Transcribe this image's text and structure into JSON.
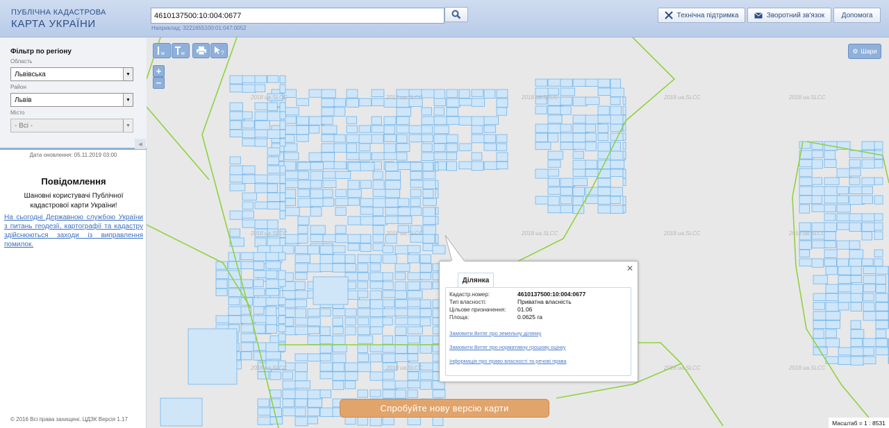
{
  "header": {
    "logo_line1": "ПУБЛІЧНА КАДАСТРОВА",
    "logo_line2": "КАРТА УКРАЇНИ",
    "search_value": "4610137500:10:004:0677",
    "hint": "Наприклад: 3221655100:01:047:0052",
    "buttons": {
      "support": "Технічна підтримка",
      "feedback": "Зворотний зв'язок",
      "help": "Допомога"
    }
  },
  "sidebar": {
    "filter_title": "Фільтр по регіону",
    "oblast_label": "Область",
    "oblast_value": "Львівська",
    "rayon_label": "Район",
    "rayon_value": "Львів",
    "city_label": "Місто",
    "city_value": "- Всі -",
    "update_date": "Дата оновлення: 05.11.2019 03:00",
    "notice_title": "Повідомлення",
    "notice_text": "Шановні користувачі Публічної кадастрової карти України!",
    "notice_link": "На сьогодні Державною службою України з питань геодезії, картографії та кадастру здійснюються заходи із виправлення помилок.",
    "copyright": "© 2016 Всі права захищені. ЦДЗК Версія 1.17"
  },
  "map": {
    "layers_label": "Шари",
    "watermark": "2018 ua.SLCC",
    "new_version": "Спробуйте нову версію карти",
    "scale": "Масштаб = 1 : 8531",
    "zoom_in": "+",
    "zoom_out": "−"
  },
  "popup": {
    "tab": "Ділянка",
    "rows": [
      {
        "k": "Кадастр.номер:",
        "v": "4610137500:10:004:0677"
      },
      {
        "k": "Тип власності:",
        "v": "Приватна власність"
      },
      {
        "k": "Цільове призначення:",
        "v": "01.06"
      },
      {
        "k": "Площа:",
        "v": "0.0625 га"
      }
    ],
    "links": [
      "Замовити Витяг про земельну ділянку",
      "Замовити Витяг про нормативну грошову оцінку",
      "Інформація про право власності та речові права"
    ]
  },
  "colors": {
    "header_bg": "#c3d3ec",
    "plot_fill": "#cfe6f9",
    "plot_stroke": "#6fb3ea",
    "boundary": "#8fd13f",
    "new_version_bg": "#e1a46b"
  }
}
